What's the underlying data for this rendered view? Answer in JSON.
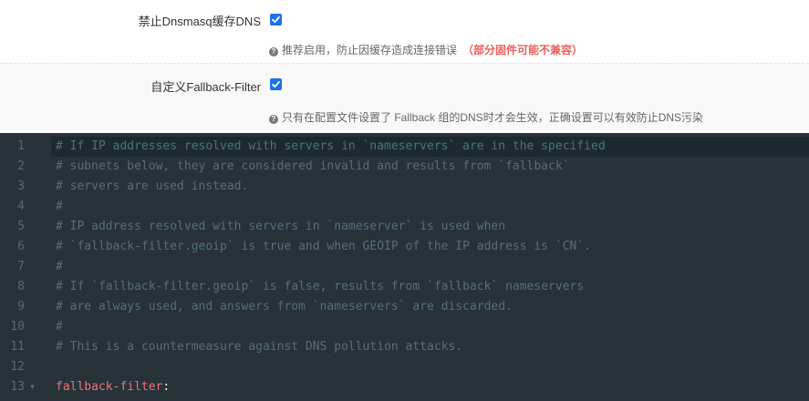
{
  "settings": {
    "dnsmasq": {
      "label": "禁止Dnsmasq缓存DNS",
      "checked": true,
      "hint": "推荐启用，防止因缓存造成连接错误",
      "warning": "（部分固件可能不兼容）"
    },
    "fallback_filter": {
      "label": "自定义Fallback-Filter",
      "checked": true,
      "hint": "只有在配置文件设置了 Fallback 组的DNS时才会生效，正确设置可以有效防止DNS污染"
    }
  },
  "editor": {
    "lines": [
      {
        "num": "1",
        "text": "# If IP addresses resolved with servers in `nameservers` are in the specified"
      },
      {
        "num": "2",
        "text": "# subnets below, they are considered invalid and results from `fallback`"
      },
      {
        "num": "3",
        "text": "# servers are used instead."
      },
      {
        "num": "4",
        "text": "#"
      },
      {
        "num": "5",
        "text": "# IP address resolved with servers in `nameserver` is used when"
      },
      {
        "num": "6",
        "text": "# `fallback-filter.geoip` is true and when GEOIP of the IP address is `CN`."
      },
      {
        "num": "7",
        "text": "#"
      },
      {
        "num": "8",
        "text": "# If `fallback-filter.geoip` is false, results from `fallback` nameservers"
      },
      {
        "num": "9",
        "text": "# are always used, and answers from `nameservers` are discarded."
      },
      {
        "num": "10",
        "text": "#"
      },
      {
        "num": "11",
        "text": "# This is a countermeasure against DNS pollution attacks."
      },
      {
        "num": "12",
        "text": ""
      },
      {
        "num": "13",
        "key": "fallback-filter",
        "colon": ":",
        "fold": "▼"
      }
    ]
  },
  "colors": {
    "accent": "#1a73e8",
    "warning": "#e8605c",
    "editor_bg": "#263238",
    "comment": "#546e7a",
    "key": "#f07178"
  },
  "icons": [
    "question-circle-icon",
    "checkbox-checked-icon",
    "fold-arrow-icon"
  ]
}
